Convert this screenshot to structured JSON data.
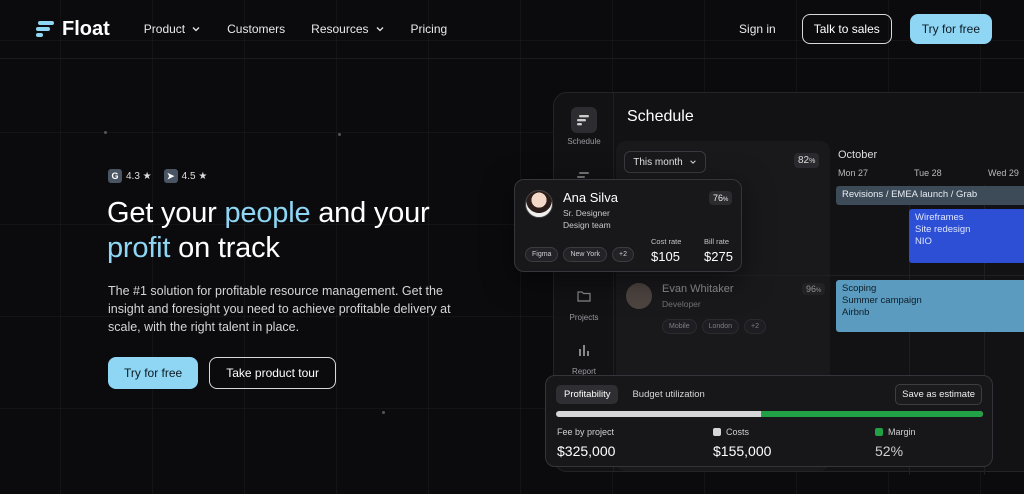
{
  "brand": {
    "name": "Float"
  },
  "nav": {
    "links": [
      "Product",
      "Customers",
      "Resources",
      "Pricing"
    ],
    "sign_in": "Sign in",
    "talk_to_sales": "Talk to sales",
    "try_free": "Try for free"
  },
  "hero": {
    "ratings": [
      {
        "badge": "G",
        "score": "4.3 ★"
      },
      {
        "badge": "➤",
        "score": "4.5 ★"
      }
    ],
    "title_parts": [
      "Get your ",
      "people",
      " and your ",
      "profit",
      " on track"
    ],
    "subtitle": "The #1 solution for profitable resource management. Get the insight and foresight you need to achieve profitable delivery at scale, with the right talent in place.",
    "cta_primary": "Try for free",
    "cta_secondary": "Take product tour"
  },
  "app": {
    "title": "Schedule",
    "sidebar": {
      "schedule": "Schedule",
      "projects": "Projects",
      "report": "Report"
    },
    "filter": "This month",
    "utilization": "82",
    "utilization_unit": "%",
    "month": "October",
    "days": [
      "Mon 27",
      "Tue 28",
      "Wed 29"
    ],
    "bars": {
      "revisions": "Revisions / EMEA launch / Grab",
      "wireframes": [
        "Wireframes",
        "Site redesign",
        "NIO"
      ],
      "scoping": [
        "Scoping",
        "Summer campaign",
        "Airbnb"
      ]
    },
    "ana": {
      "name": "Ana Silva",
      "role": "Sr. Designer",
      "team": "Design team",
      "pct": "76",
      "pct_unit": "%",
      "tags": [
        "Figma",
        "New York",
        "+2"
      ],
      "cost_rate_label": "Cost rate",
      "cost_rate": "$105",
      "bill_rate_label": "Bill rate",
      "bill_rate": "$275"
    },
    "evan": {
      "name": "Evan Whitaker",
      "role": "Developer",
      "pct": "96",
      "pct_unit": "%",
      "tags": [
        "Mobile",
        "London",
        "+2"
      ]
    },
    "profit": {
      "tabs": [
        "Profitability",
        "Budget utilization"
      ],
      "save": "Save as estimate",
      "margin_share": 0.52,
      "fee_label": "Fee by project",
      "fee": "$325,000",
      "costs_label": "Costs",
      "costs": "$155,000",
      "margin_label": "Margin",
      "margin": "52%"
    }
  },
  "colors": {
    "accent": "#8fd6f5",
    "margin_green": "#22a046",
    "wireframes_blue": "#2c4fd6",
    "scoping_teal": "#5b9bbf"
  }
}
